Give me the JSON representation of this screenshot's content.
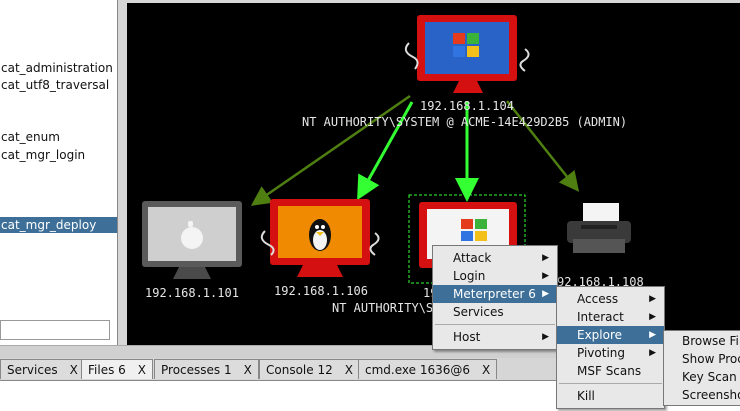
{
  "module_tree": {
    "items": [
      {
        "label": "cat_administration",
        "selected": false
      },
      {
        "label": "cat_utf8_traversal",
        "selected": false
      },
      {
        "label": "cat_enum",
        "selected": false
      },
      {
        "label": "cat_mgr_login",
        "selected": false
      },
      {
        "label": "cat_mgr_deploy",
        "selected": true
      }
    ]
  },
  "graph": {
    "hosts": [
      {
        "id": "host-104",
        "os": "windows",
        "ip": "192.168.1.104",
        "session_label": "NT AUTHORITY\\SYSTEM @ ACME-14E429D2B5 (ADMIN)",
        "compromised": true
      },
      {
        "id": "host-101",
        "os": "apple",
        "ip": "192.168.1.101",
        "compromised": false
      },
      {
        "id": "host-106",
        "os": "linux",
        "ip": "192.168.1.106",
        "compromised": true
      },
      {
        "id": "host-selected",
        "os": "windows-legacy",
        "ip": "19",
        "session_label": "NT AUTHORITY\\S",
        "compromised": true,
        "selected": true
      },
      {
        "id": "host-108",
        "os": "printer",
        "ip": "92.168.1.108",
        "compromised": false
      }
    ],
    "colors": {
      "pivot_bright": "#33ff33",
      "pivot_dim": "#4f7f10",
      "compromised_frame": "#e01010",
      "compromised_screen": "#ff9000"
    }
  },
  "tabs": [
    {
      "label": "Services",
      "close": "X",
      "active": false
    },
    {
      "label": "Files 6",
      "close": "X",
      "active": true
    },
    {
      "label": "Processes 1",
      "close": "X",
      "active": false
    },
    {
      "label": "Console 12",
      "close": "X",
      "active": false
    },
    {
      "label": "cmd.exe 1636@6",
      "close": "X",
      "active": false
    }
  ],
  "menus": {
    "host_menu": [
      {
        "label": "Attack",
        "submenu": true
      },
      {
        "label": "Login",
        "submenu": true
      },
      {
        "label": "Meterpreter 6",
        "submenu": true,
        "highlighted": true
      },
      {
        "label": "Services",
        "submenu": false
      },
      {
        "label": "Host",
        "submenu": true
      }
    ],
    "meterpreter_menu": [
      {
        "label": "Access",
        "submenu": true
      },
      {
        "label": "Interact",
        "submenu": true
      },
      {
        "label": "Explore",
        "submenu": true,
        "highlighted": true
      },
      {
        "label": "Pivoting",
        "submenu": true
      },
      {
        "label": "MSF Scans",
        "submenu": false
      },
      {
        "label": "Kill",
        "submenu": false
      }
    ],
    "explore_menu": [
      {
        "label": "Browse Fil"
      },
      {
        "label": "Show Proc"
      },
      {
        "label": "Key Scan"
      },
      {
        "label": "Screensho"
      }
    ]
  }
}
